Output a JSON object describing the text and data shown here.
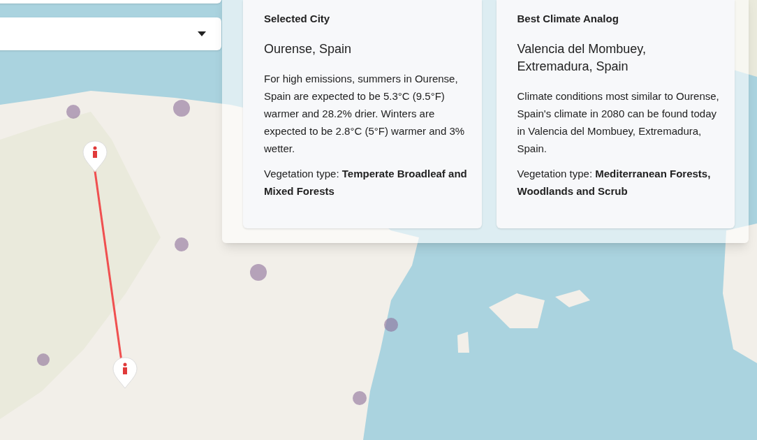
{
  "cards": [
    {
      "heading": "Selected City",
      "place": "Ourense, Spain",
      "description": "For high emissions, summers in Ourense, Spain are expected to be 5.3°C (9.5°F) warmer and 28.2% drier. Winters are expected to be 2.8°C (5°F) warmer and 3% wetter.",
      "vegetation": "Vegetation type: **Temperate Broadleaf and Mixed Forests**"
    },
    {
      "heading": "Best Climate Analog",
      "place": "Valencia del Mombuey, Extremadura, Spain",
      "description": "Climate conditions most similar to Ourense, Spain's climate in 2080 can be found today in Valencia del Mombuey, Extremadura, Spain.",
      "vegetation": "Vegetation type: **Mediterranean Forests, Woodlands and Scrub**"
    }
  ]
}
